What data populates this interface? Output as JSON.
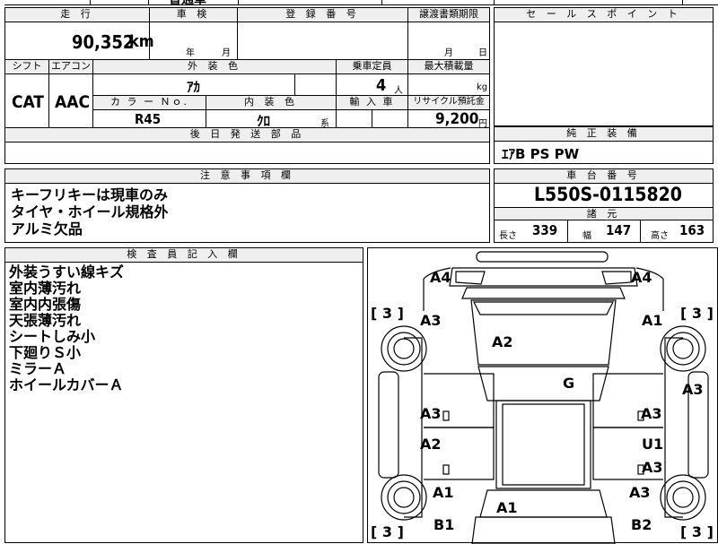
{
  "vehicle": {
    "top_text": "普通車",
    "mileage_header": "走 行",
    "mileage_value": "90,352",
    "mileage_unit": "km",
    "inspection_header": "車 検",
    "inspection_year_label": "年",
    "inspection_month_label": "月",
    "registration_header": "登 録 番 号",
    "transfer_doc_header": "譲渡書類期限",
    "transfer_month_label": "月",
    "transfer_day_label": "日",
    "shift_header": "シフト",
    "shift_value": "CAT",
    "aircon_header": "エアコン",
    "aircon_value": "AAC",
    "exterior_color_header": "外 装 色",
    "exterior_color_value": "ｱｶ",
    "capacity_header": "乗車定員",
    "capacity_value": "4",
    "capacity_unit": "人",
    "max_load_header": "最大積載量",
    "max_load_unit": "kg",
    "color_no_header": "カ ラ ー Ｎｏ.",
    "color_no_value": "R45",
    "interior_color_header": "内 装 色",
    "interior_color_value": "ｸﾛ",
    "interior_color_suffix": "系",
    "import_header": "輸 入 車",
    "recycle_header": "リサイクル預託金",
    "recycle_value": "9,200",
    "recycle_unit": "円",
    "later_parts_header": "後 日 発 送 部 品"
  },
  "sales_point": {
    "header": "セ ー ル ス ポ イ ン ト"
  },
  "equipment": {
    "header": "純 正 装 備",
    "value": "ｴｱB PS PW"
  },
  "notes": {
    "header": "注 意 事 項 欄",
    "lines": [
      "キーフリキーは現車のみ",
      "タイヤ・ホイール規格外",
      "アルミ欠品"
    ]
  },
  "chassis": {
    "header": "車 台 番 号",
    "value": "L550S-0115820",
    "specs_header": "諸 元",
    "length_label": "長さ",
    "length_value": "339",
    "width_label": "幅",
    "width_value": "147",
    "height_label": "高さ",
    "height_value": "163"
  },
  "inspector": {
    "header": "検 査 員 記 入 欄",
    "lines": [
      "外装うすい線キズ",
      "室内薄汚れ",
      "室内内張傷",
      "天張薄汚れ",
      "シートしみ小",
      "下廻りＳ小",
      "ミラーＡ",
      "ホイールカバーＡ"
    ]
  },
  "diagram": {
    "tread_left": "[ 3 ]",
    "tread_right": "[ 3 ]",
    "tread_bl": "[ 3 ]",
    "tread_br": "[ 3 ]",
    "m_a4_left": "A4",
    "m_a4_right": "A4",
    "m_a3_fl": "A3",
    "m_a1_fr": "A1",
    "m_a2_hood": "A2",
    "m_g": "G",
    "m_a3_right_side": "A3",
    "m_a3_l1": "A3",
    "m_a3_r1": "A3",
    "m_a2_l2": "A2",
    "m_u1_r2": "U1",
    "m_a3_r2": "A3",
    "m_a1_l3": "A1",
    "m_a3_r3": "A3",
    "m_a1_rear": "A1",
    "m_b1": "B1",
    "m_b2": "B2"
  }
}
